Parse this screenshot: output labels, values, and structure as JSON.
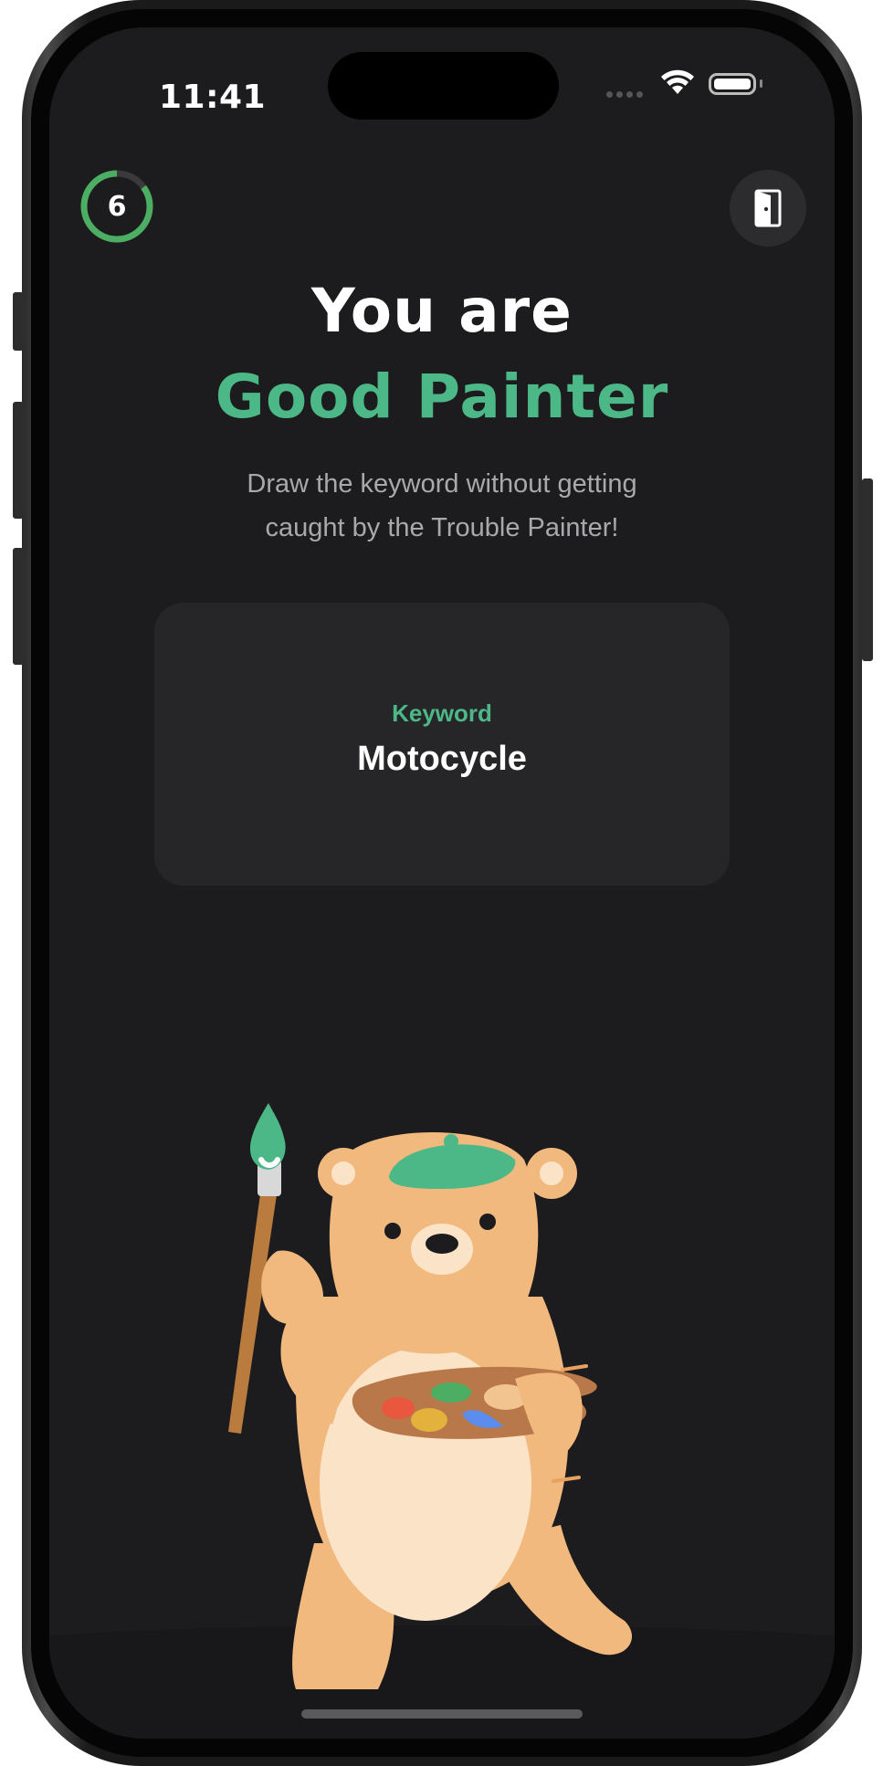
{
  "status_bar": {
    "time": "11:41"
  },
  "timer": {
    "value": "6",
    "remaining_fraction": 0.85,
    "color": "#4cae63"
  },
  "headline": {
    "line1": "You are",
    "line2": "Good Painter"
  },
  "subtitle": {
    "line1": "Draw the keyword without getting",
    "line2": "caught by the Trouble Painter!"
  },
  "keyword_card": {
    "label": "Keyword",
    "value": "Motocycle"
  },
  "colors": {
    "background": "#1c1c1e",
    "accent": "#4db887",
    "card": "#262628"
  },
  "icons": {
    "exit": "exit-door-icon",
    "wifi": "wifi-icon",
    "battery": "battery-icon"
  }
}
